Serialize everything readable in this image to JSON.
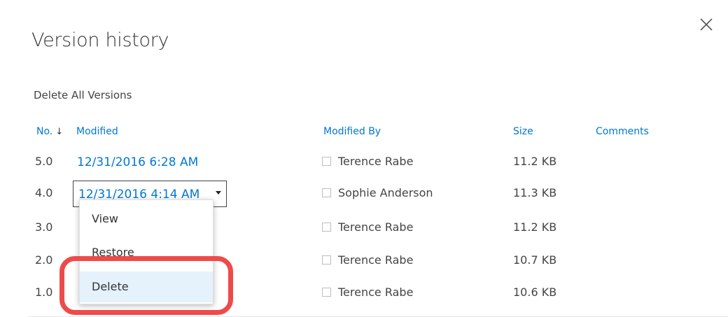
{
  "dialog": {
    "title": "Version history",
    "close_icon": "close-icon",
    "delete_all_label": "Delete All Versions"
  },
  "table": {
    "headers": {
      "no": "No.",
      "sort_indicator": "↓",
      "modified": "Modified",
      "modified_by": "Modified By",
      "size": "Size",
      "comments": "Comments"
    },
    "rows": [
      {
        "no": "5.0",
        "modified": "12/31/2016 6:28 AM",
        "modified_by": "Terence Rabe",
        "size": "11.2 KB"
      },
      {
        "no": "4.0",
        "modified": "12/31/2016 4:14 AM",
        "modified_by": "Sophie Anderson",
        "size": "11.3 KB"
      },
      {
        "no": "3.0",
        "modified": "",
        "modified_by": "Terence Rabe",
        "size": "11.2 KB"
      },
      {
        "no": "2.0",
        "modified": "",
        "modified_by": "Terence Rabe",
        "size": "10.7 KB"
      },
      {
        "no": "1.0",
        "modified": "",
        "modified_by": "Terence Rabe",
        "size": "10.6 KB"
      }
    ]
  },
  "context_menu": {
    "items": [
      {
        "label": "View"
      },
      {
        "label": "Restore"
      },
      {
        "label": "Delete"
      }
    ],
    "highlighted": "Delete"
  },
  "colors": {
    "link": "#0078d4",
    "highlight_ring": "#ef4a4a",
    "menu_selected_bg": "#e5f1fb"
  }
}
